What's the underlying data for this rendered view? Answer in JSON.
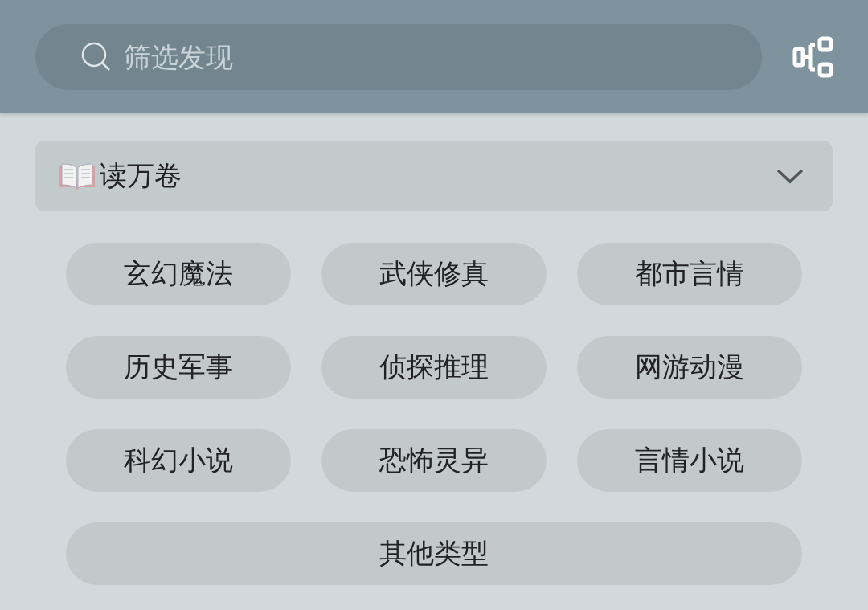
{
  "search": {
    "placeholder": "筛选发现"
  },
  "group": {
    "title": "读万卷",
    "expanded": true,
    "tags": [
      "玄幻魔法",
      "武侠修真",
      "都市言情",
      "历史军事",
      "侦探推理",
      "网游动漫",
      "科幻小说",
      "恐怖灵异",
      "言情小说",
      "其他类型"
    ]
  }
}
